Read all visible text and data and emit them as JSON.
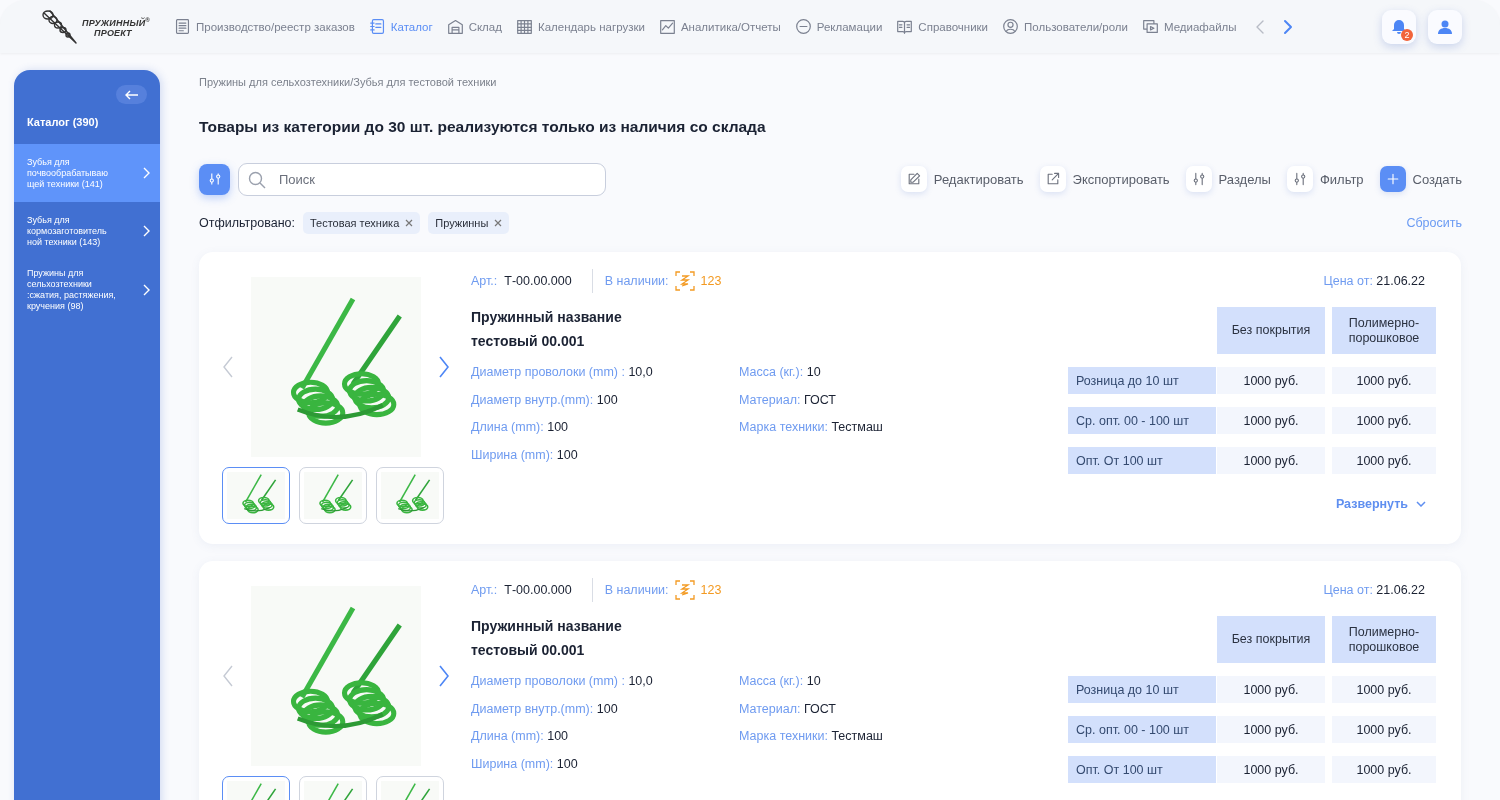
{
  "logo": {
    "line_1": "ПРУЖИННЫЙ",
    "line_2": "ПРОЕКТ",
    "mark": "®"
  },
  "nav": {
    "items": [
      {
        "label": "Производство/реестр заказов",
        "selected": false
      },
      {
        "label": "Каталог",
        "selected": true
      },
      {
        "label": "Склад",
        "selected": false
      },
      {
        "label": "Календарь нагрузки",
        "selected": false
      },
      {
        "label": "Аналитика/Отчеты",
        "selected": false
      },
      {
        "label": "Рекламации",
        "selected": false
      },
      {
        "label": "Справочники",
        "selected": false
      },
      {
        "label": "Пользователи/роли",
        "selected": false
      },
      {
        "label": "Медиафайлы",
        "selected": false
      }
    ],
    "notification_badge": "2"
  },
  "sidebar": {
    "title": "Каталог (390)",
    "items": [
      {
        "label": "Зубья для почвообрабатываю щей техники (141)",
        "selected": true
      },
      {
        "label": "Зубья для кормозаготовитель ной техники (143)",
        "selected": false
      },
      {
        "label": "Пружины для сельхозтехники :сжатия, растяжения, кручения (98)",
        "selected": false
      }
    ]
  },
  "breadcrumb": "Пружины для сельхозтехники/Зубья для тестовой техники",
  "heading": "Товары из категории до 30 шт. реализуются только из наличия со склада",
  "search": {
    "placeholder": "Поиск"
  },
  "actions": [
    {
      "label": "Редактировать",
      "kind": "edit"
    },
    {
      "label": "Экспортировать",
      "kind": "export"
    },
    {
      "label": "Разделы",
      "kind": "sections"
    },
    {
      "label": "Фильтр",
      "kind": "filter"
    },
    {
      "label": "Создать",
      "kind": "create"
    }
  ],
  "filters": {
    "label": "Отфильтровано:",
    "tags": [
      "Тестовая техника",
      "Пружинны"
    ],
    "reset": "Сбросить"
  },
  "products": [
    {
      "article_label": "Арт.:",
      "article": "Т-00.00.000",
      "stock_label": "В наличии:",
      "stock": "123",
      "price_label": "Цена от:",
      "price_date": "21.06.22",
      "name": "Пружинный название тестовый 00.001",
      "specs_left": [
        {
          "label": "Диаметр проволоки (mm) :",
          "value": "10,0"
        },
        {
          "label": "Диаметр внутр.(mm):",
          "value": "100"
        },
        {
          "label": "Длина (mm):",
          "value": "100"
        },
        {
          "label": "Ширина (mm):",
          "value": "100"
        }
      ],
      "specs_right": [
        {
          "label": "Масса (кг.):",
          "value": "10"
        },
        {
          "label": "Материал:",
          "value": "ГОСТ"
        },
        {
          "label": "Марка техники:",
          "value": "Тестмаш"
        }
      ],
      "price_columns": [
        "Без покрытия",
        "Полимерно-порошковое"
      ],
      "price_rows": [
        {
          "label": "Розница до 10 шт",
          "values": [
            "1000 руб.",
            "1000 руб."
          ]
        },
        {
          "label": "Ср. опт. 00 - 100 шт",
          "values": [
            "1000 руб.",
            "1000 руб."
          ]
        },
        {
          "label": "Опт. От 100 шт",
          "values": [
            "1000 руб.",
            "1000 руб."
          ]
        }
      ],
      "thumbnails": [
        {
          "selected": true
        },
        {
          "selected": false
        },
        {
          "selected": false
        }
      ],
      "expand": "Развернуть"
    },
    {
      "article_label": "Арт.:",
      "article": "Т-00.00.000",
      "stock_label": "В наличии:",
      "stock": "123",
      "price_label": "Цена от:",
      "price_date": "21.06.22",
      "name": "Пружинный название тестовый 00.001",
      "specs_left": [
        {
          "label": "Диаметр проволоки (mm) :",
          "value": "10,0"
        },
        {
          "label": "Диаметр внутр.(mm):",
          "value": "100"
        },
        {
          "label": "Длина (mm):",
          "value": "100"
        },
        {
          "label": "Ширина (mm):",
          "value": "100"
        }
      ],
      "specs_right": [
        {
          "label": "Масса (кг.):",
          "value": "10"
        },
        {
          "label": "Материал:",
          "value": "ГОСТ"
        },
        {
          "label": "Марка техники:",
          "value": "Тестмаш"
        }
      ],
      "price_columns": [
        "Без покрытия",
        "Полимерно-порошковое"
      ],
      "price_rows": [
        {
          "label": "Розница до 10 шт",
          "values": [
            "1000 руб.",
            "1000 руб."
          ]
        },
        {
          "label": "Ср. опт. 00 - 100 шт",
          "values": [
            "1000 руб.",
            "1000 руб."
          ]
        },
        {
          "label": "Опт. От 100 шт",
          "values": [
            "1000 руб.",
            "1000 руб."
          ]
        }
      ],
      "thumbnails": [
        {
          "selected": true
        },
        {
          "selected": false
        },
        {
          "selected": false
        }
      ]
    }
  ]
}
